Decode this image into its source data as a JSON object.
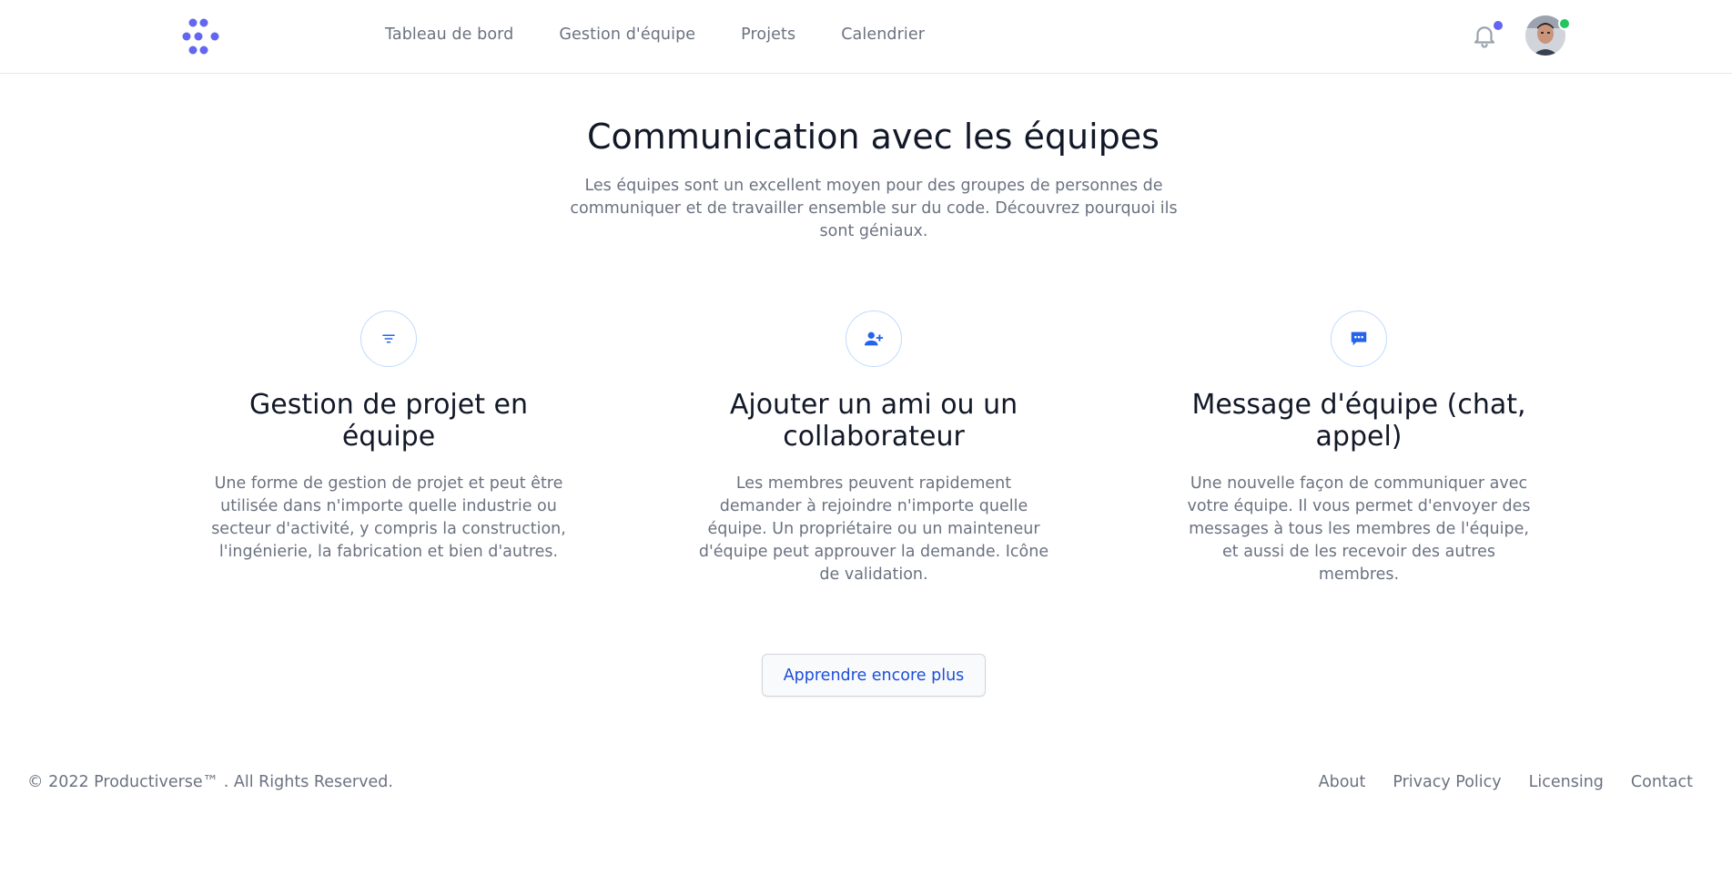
{
  "header": {
    "logo_icon": "productiverse-logo-icon",
    "nav": [
      "Tableau de bord",
      "Gestion d'équipe",
      "Projets",
      "Calendrier"
    ],
    "bell_icon": "bell-icon",
    "colors": {
      "accent": "#6366f1",
      "online": "#22c55e"
    }
  },
  "hero": {
    "title": "Communication avec les équipes",
    "subtitle": "Les équipes sont un excellent moyen pour des groupes de personnes de communiquer et de travailler ensemble sur du code. Découvrez pourquoi ils sont géniaux."
  },
  "features": [
    {
      "icon": "filter-lines-icon",
      "title": "Gestion de projet en équipe",
      "text": "Une forme de gestion de projet et peut être utilisée dans n'importe quelle industrie ou secteur d'activité, y compris la construction, l'ingénierie, la fabrication et bien d'autres."
    },
    {
      "icon": "user-add-icon",
      "title": "Ajouter un ami ou un collaborateur",
      "text": "Les membres peuvent rapidement demander à rejoindre n'importe quelle équipe. Un propriétaire ou un mainteneur d'équipe peut approuver la demande. Icône de validation."
    },
    {
      "icon": "chat-bubble-icon",
      "title": "Message d'équipe (chat, appel)",
      "text": "Une nouvelle façon de communiquer avec votre équipe. Il vous permet d'envoyer des messages à tous les membres de l'équipe, et aussi de les recevoir des autres membres."
    }
  ],
  "cta": {
    "label": "Apprendre encore plus",
    "color": "#1d4ed8"
  },
  "footer": {
    "copyright": "© 2022 Productiverse™ . All Rights Reserved.",
    "links": [
      "About",
      "Privacy Policy",
      "Licensing",
      "Contact"
    ]
  }
}
